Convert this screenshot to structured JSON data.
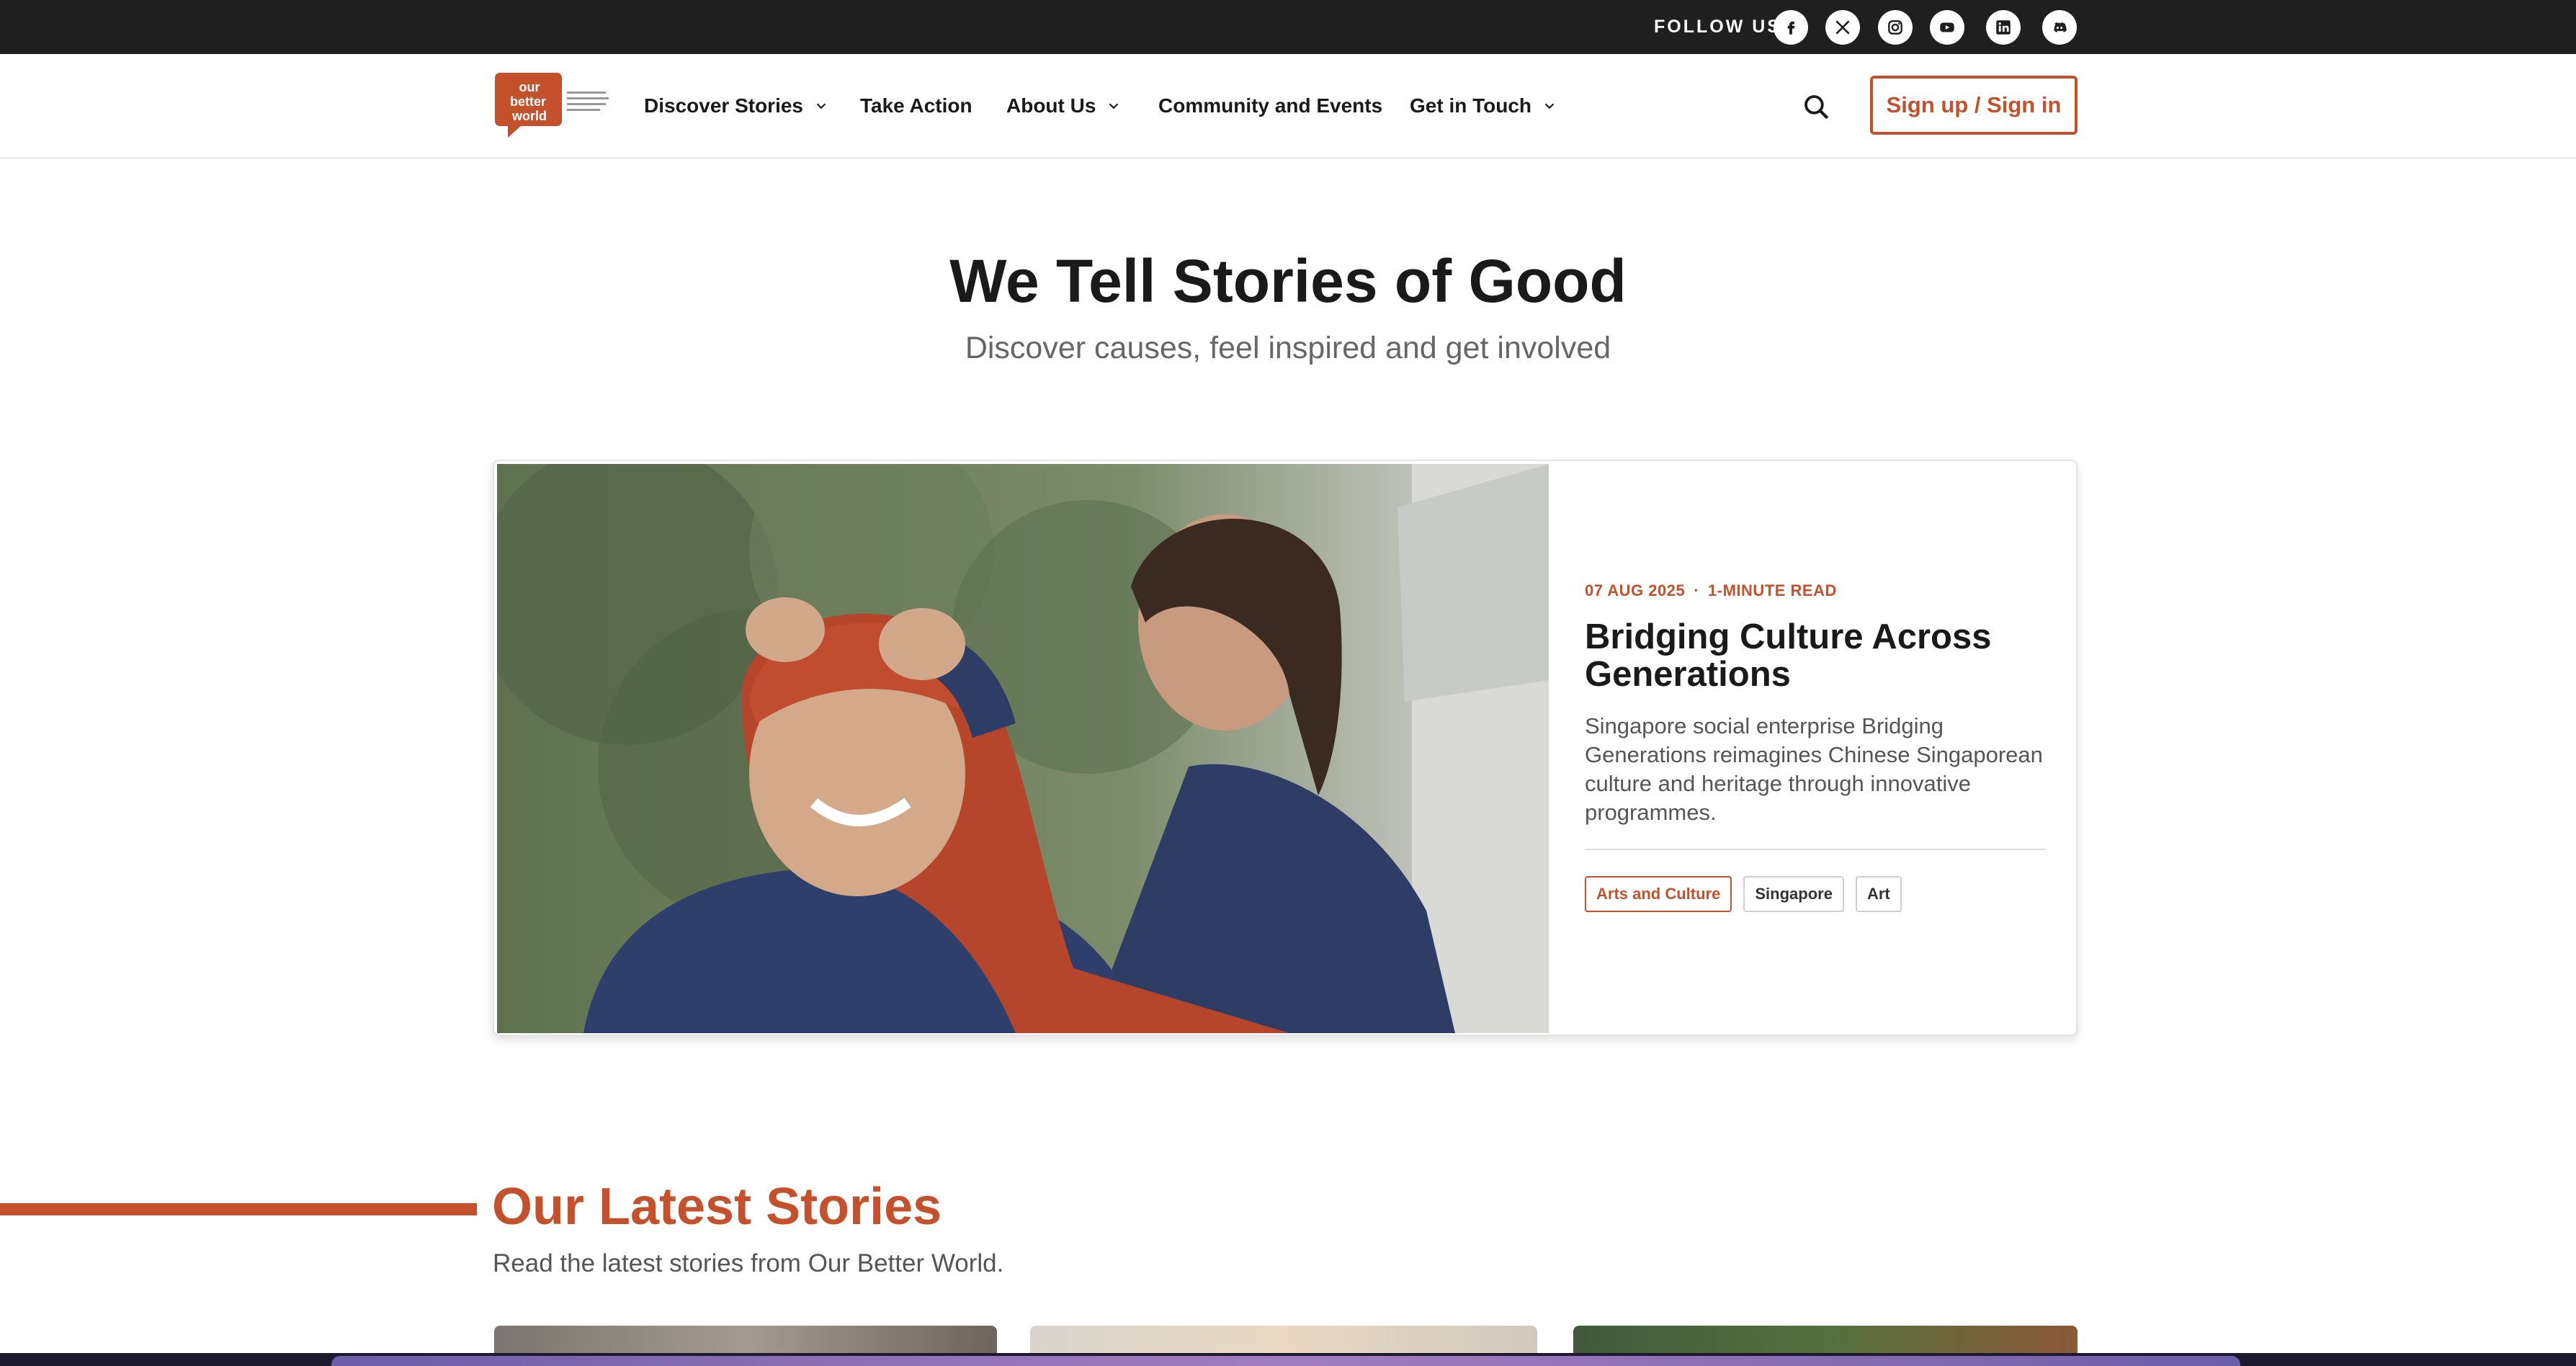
{
  "topbar": {
    "follow_label": "FOLLOW US",
    "socials": [
      "facebook-icon",
      "x-icon",
      "instagram-icon",
      "youtube-icon",
      "linkedin-icon",
      "discord-icon"
    ]
  },
  "nav": {
    "logo_text": [
      "our",
      "better",
      "world"
    ],
    "items": [
      {
        "label": "Discover Stories",
        "dropdown": true
      },
      {
        "label": "Take Action",
        "dropdown": false
      },
      {
        "label": "About Us",
        "dropdown": true
      },
      {
        "label": "Community and Events",
        "dropdown": false
      },
      {
        "label": "Get in Touch",
        "dropdown": true
      }
    ],
    "signup_label": "Sign up / Sign in"
  },
  "hero": {
    "title": "We Tell Stories of Good",
    "subtitle": "Discover causes, feel inspired and get involved"
  },
  "featured": {
    "date": "07 AUG 2025",
    "read_time": "1-MINUTE READ",
    "title": "Bridging Culture Across Generations",
    "description": "Singapore social enterprise Bridging Generations reimagines Chinese Singaporean culture and heritage through innovative programmes.",
    "tags": [
      "Arts and Culture",
      "Singapore",
      "Art"
    ]
  },
  "latest": {
    "title": "Our Latest Stories",
    "subtitle": "Read the latest stories from Our Better World."
  },
  "colors": {
    "accent": "#c4512b",
    "topbar": "#1f1f1f"
  }
}
